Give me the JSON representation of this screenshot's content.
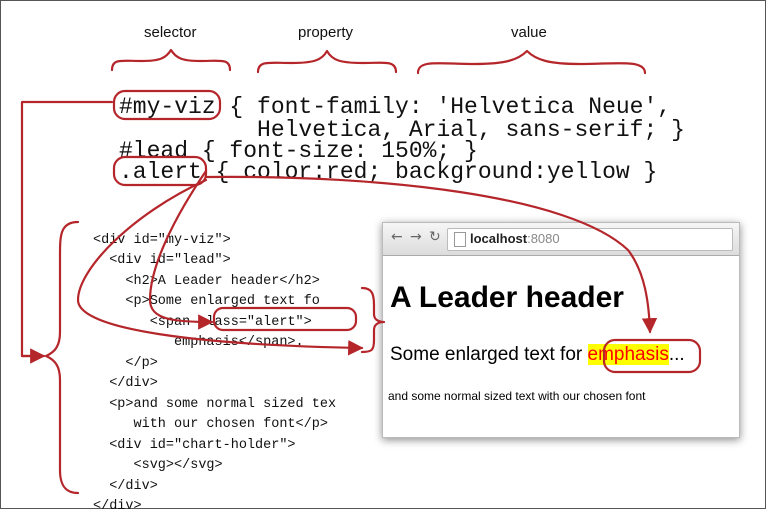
{
  "captions": {
    "selector": "selector",
    "property": "property",
    "value": "value"
  },
  "css_lines": [
    "#my-viz { font-family: 'Helvetica Neue',",
    "          Helvetica, Arial, sans-serif; }",
    "#lead { font-size: 150%; }",
    ".alert { color:red; background:yellow }"
  ],
  "html_code": {
    "l1": "<div id=\"my-viz\">",
    "l2": "  <div id=\"lead\">",
    "l3": "    <h2>A Leader header</h2>",
    "l4": "    <p>Some enlarged text fo",
    "l5a": "       <span ",
    "l5b": "class=\"alert\">",
    "l6": "          emphasis</span>.",
    "l7": "    </p>",
    "l8": "  </div>",
    "l9": "  <p>and some normal sized tex",
    "l10": "     with our chosen font</p>",
    "l11": "  <div id=\"chart-holder\">",
    "l12": "     <svg></svg>",
    "l13": "  </div>",
    "l14": "</div>"
  },
  "browser": {
    "url_host": "localhost",
    "url_port": ":8080",
    "heading": "A Leader header",
    "para_text": "Some enlarged text for ",
    "emphasis": "emphasis",
    "para_end": "...",
    "small_text": "and some normal sized text with our chosen font"
  },
  "colors": {
    "annotation": "#b5262b",
    "alert_text": "#ff0000",
    "alert_bg": "#ffff00"
  },
  "icons": [
    "back-arrow-icon",
    "forward-arrow-icon",
    "reload-icon",
    "page-icon"
  ]
}
